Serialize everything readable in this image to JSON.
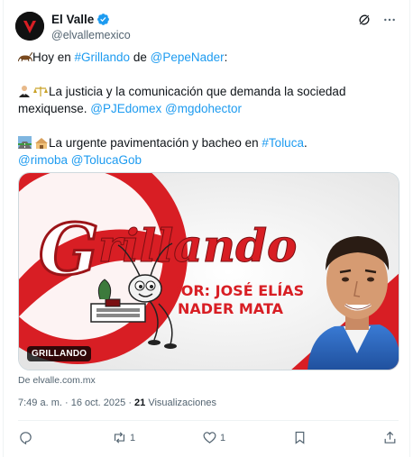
{
  "account": {
    "name": "El Valle",
    "handle": "@elvallemexico",
    "verified": true,
    "brand_color": "#d81e24"
  },
  "tweet": {
    "line1": {
      "prefix": "Hoy en ",
      "hashtag": "#Grillando",
      "mid": " de ",
      "mention": "@PepeNader",
      "suffix": ":"
    },
    "line2": {
      "text": "La justicia y la comunicación que demanda la sociedad mexiquense. ",
      "mention1": "@PJEdomex",
      "mention2": "@mgdohector"
    },
    "line3": {
      "text": "La urgente pavimentación y bacheo en ",
      "hashtag": "#Toluca",
      "suffix": ".",
      "mention1": "@rimoba",
      "mention2": "@TolucaGob"
    },
    "emoji1": "cricket-emoji",
    "emoji2": "judge-and-scales-emoji",
    "emoji3": "road-and-construction-emoji"
  },
  "card": {
    "title_script": "Grillando",
    "byline_line1": "POR: JOSÉ ELÍAS",
    "byline_line2": "NADER MATA",
    "badge": "GRILLANDO",
    "source": "De elvalle.com.mx",
    "red": "#d81e24",
    "dark_red": "#9c1418"
  },
  "meta": {
    "time": "7:49 a. m.",
    "sep": " · ",
    "date": "16 oct. 2025",
    "views_count": "21",
    "views_label": " Visualizaciones"
  },
  "actions": {
    "reply_count": "",
    "retweet_count": "1",
    "like_count": "1"
  },
  "colors": {
    "link": "#1d9bf0",
    "muted": "#536471",
    "verified": "#1d9bf0"
  }
}
